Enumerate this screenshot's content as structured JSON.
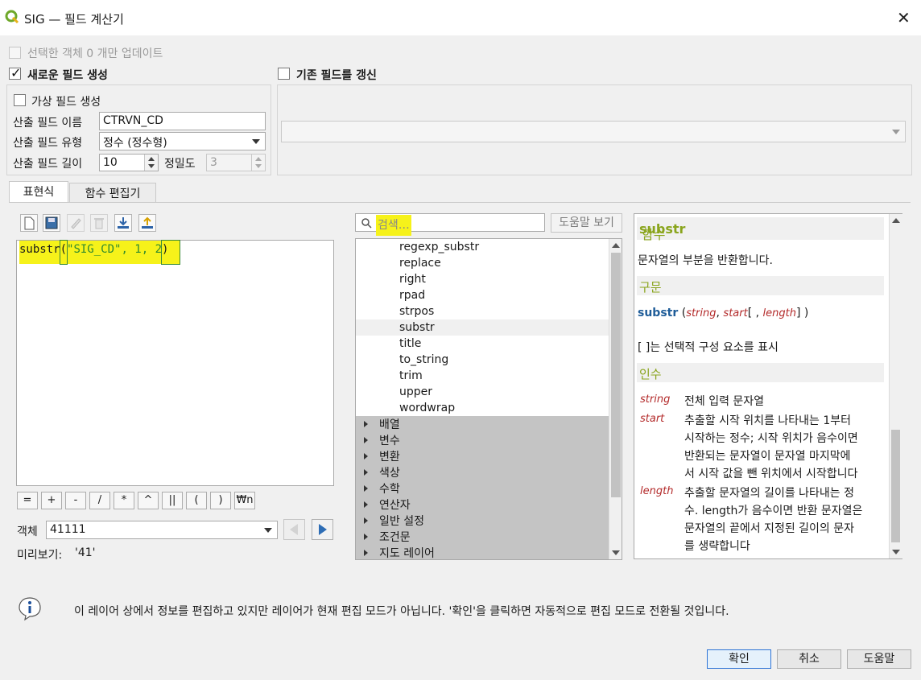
{
  "window": {
    "title": "SIG — 필드 계산기",
    "close_glyph": "✕"
  },
  "options": {
    "update_selected_label": "선택한 객체 0 개만 업데이트",
    "create_new_field_label": "새로운 필드 생성",
    "update_existing_field_label": "기존 필드를 갱신",
    "create_virtual_field_label": "가상 필드 생성"
  },
  "new_field": {
    "name_label": "산출 필드 이름",
    "name_value": "CTRVN_CD",
    "type_label": "산출 필드 유형",
    "type_value": "정수 (정수형)",
    "length_label": "산출 필드 길이",
    "length_value": "10",
    "precision_label": "정밀도",
    "precision_value": "3"
  },
  "tabs": {
    "expression": "표현식",
    "function_editor": "함수 편집기"
  },
  "expression": {
    "parts": [
      "substr",
      "(",
      "\"SIG_CD\", 1, 2",
      ")"
    ]
  },
  "operators": [
    "=",
    "+",
    "-",
    "/",
    "*",
    "^",
    "||",
    "(",
    ")",
    "₩n"
  ],
  "feature": {
    "label": "객체",
    "value": "41111"
  },
  "preview": {
    "label": "미리보기:",
    "value": "'41'"
  },
  "search": {
    "placeholder": "검색…",
    "help_button": "도움말 보기"
  },
  "function_list": [
    "regexp_substr",
    "replace",
    "right",
    "rpad",
    "strpos",
    "substr",
    "title",
    "to_string",
    "trim",
    "upper",
    "wordwrap"
  ],
  "function_groups": [
    "배열",
    "변수",
    "변환",
    "색상",
    "수학",
    "연산자",
    "일반 설정",
    "조건문",
    "지도 레이어"
  ],
  "help": {
    "title_prefix": "함수",
    "title_func": "substr",
    "description": "문자열의 부분을 반환합니다.",
    "syntax_heading": "구문",
    "syntax": {
      "func": "substr",
      "open": " (",
      "arg1": "string",
      "comma1": ", ",
      "arg2": "start",
      "opt": "[ , ",
      "arg3": "length",
      "close": "] )"
    },
    "optional_note": "[ ]는 선택적 구성 요소를 표시",
    "args_heading": "인수",
    "args": [
      {
        "name": "string",
        "lines": [
          "전체 입력 문자열"
        ]
      },
      {
        "name": "start",
        "lines": [
          "추출할 시작 위치를 나타내는 1부터",
          "시작하는 정수; 시작 위치가 음수이면",
          "반환되는 문자열이 문자열 마지막에",
          "서 시작 값을 뺀 위치에서 시작합니다"
        ]
      },
      {
        "name": "length",
        "lines": [
          "추출할 문자열의 길이를 나타내는 정",
          "수. length가 음수이면 반환 문자열은",
          "문자열의 끝에서 지정된 길이의 문자",
          "를 생략합니다"
        ]
      }
    ]
  },
  "info_message": "이 레이어 상에서 정보를 편집하고 있지만 레이어가 현재 편집 모드가 아닙니다. '확인'을 클릭하면 자동적으로 편집 모드로 전환될 것입니다.",
  "buttons": {
    "ok": "확인",
    "cancel": "취소",
    "help": "도움말"
  },
  "colors": {
    "highlight": "#f6f21a",
    "help_heading": "#8aa51d",
    "arg_name": "#b32a2a",
    "func_name": "#1f5d99"
  }
}
